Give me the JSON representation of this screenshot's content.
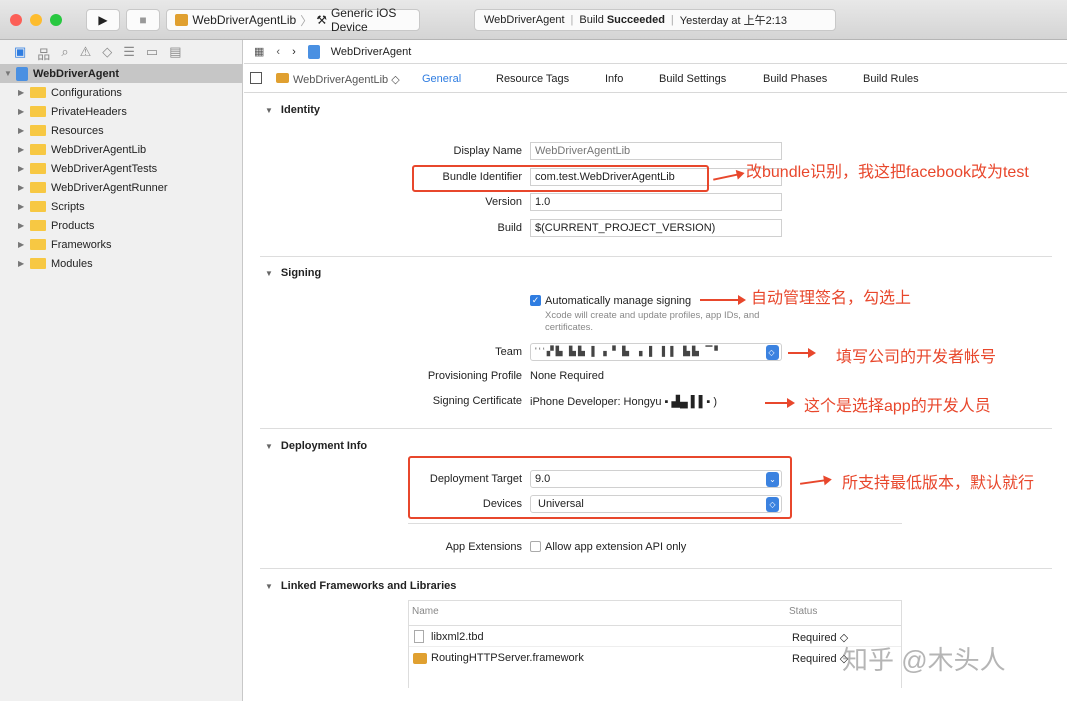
{
  "titlebar": {
    "scheme": "WebDriverAgentLib",
    "device": "Generic iOS Device",
    "status_project": "WebDriverAgent",
    "status_build": "Build",
    "status_result": "Succeeded",
    "status_time": "Yesterday at 上午2:13"
  },
  "navbar": {
    "breadcrumb": "WebDriverAgent"
  },
  "sidebar": {
    "root": "WebDriverAgent",
    "items": [
      "Configurations",
      "PrivateHeaders",
      "Resources",
      "WebDriverAgentLib",
      "WebDriverAgentTests",
      "WebDriverAgentRunner",
      "Scripts",
      "Products",
      "Frameworks",
      "Modules"
    ]
  },
  "tabs": {
    "target": "WebDriverAgentLib",
    "items": [
      "General",
      "Resource Tags",
      "Info",
      "Build Settings",
      "Build Phases",
      "Build Rules"
    ]
  },
  "identity": {
    "title": "Identity",
    "display_name_label": "Display Name",
    "display_name_placeholder": "WebDriverAgentLib",
    "bundle_label": "Bundle Identifier",
    "bundle_value": "com.test.WebDriverAgentLib",
    "version_label": "Version",
    "version_value": "1.0",
    "build_label": "Build",
    "build_value": "$(CURRENT_PROJECT_VERSION)"
  },
  "signing": {
    "title": "Signing",
    "auto_label": "Automatically manage signing",
    "auto_note": "Xcode will create and update profiles, app IDs, and certificates.",
    "team_label": "Team",
    "team_value": "'ʻʻ▞▙ ▙▙   ▌▗▝ ▙ ▗ ▌ ▌▌ ▙▙   ▔▘",
    "profile_label": "Provisioning Profile",
    "profile_value": "None Required",
    "cert_label": "Signing Certificate",
    "cert_value": "iPhone Developer: Hongyu ▪     ▟▄  ▌▌▪ )"
  },
  "deployment": {
    "title": "Deployment Info",
    "target_label": "Deployment Target",
    "target_value": "9.0",
    "devices_label": "Devices",
    "devices_value": "Universal",
    "ext_label": "App Extensions",
    "ext_checkbox": "Allow app extension API only"
  },
  "linked": {
    "title": "Linked Frameworks and Libraries",
    "col_name": "Name",
    "col_status": "Status",
    "rows": [
      {
        "name": "libxml2.tbd",
        "status": "Required ◇"
      },
      {
        "name": "RoutingHTTPServer.framework",
        "status": "Required ◇"
      }
    ]
  },
  "annotations": {
    "bundle": "改bundle识别，我这把facebook改为test",
    "signing": "自动管理签名，勾选上",
    "team": "填写公司的开发者帐号",
    "cert": "这个是选择app的开发人员",
    "deploy": "所支持最低版本，默认就行"
  },
  "watermark": "知乎 @木头人",
  "colors": {
    "accent": "#2f7de1",
    "annotation": "#e8472c"
  }
}
